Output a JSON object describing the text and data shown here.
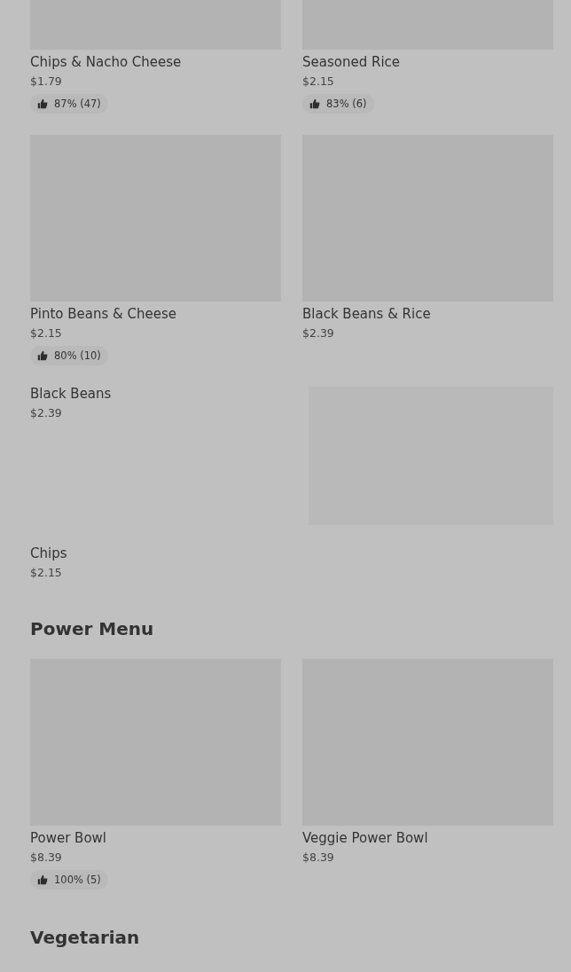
{
  "sections": [
    {
      "items": [
        {
          "kind": "photo-dish",
          "name": "Chips & Nacho Cheese",
          "price": "$1.79",
          "rating": "87% (47)"
        },
        {
          "kind": "photo-dish",
          "name": "Seasoned Rice",
          "price": "$2.15",
          "rating": "83% (6)"
        },
        {
          "kind": "photo-dish",
          "name": "Pinto Beans & Cheese",
          "price": "$2.15",
          "rating": "80% (10)"
        },
        {
          "kind": "photo-dish",
          "name": "Black Beans & Rice",
          "price": "$2.39"
        },
        {
          "kind": "text-dish",
          "name": "Black Beans",
          "price": "$2.39"
        },
        {
          "kind": "tile"
        },
        {
          "kind": "text-dish",
          "name": "Chips",
          "price": "$2.15"
        }
      ]
    },
    {
      "title": "Power Menu",
      "items": [
        {
          "kind": "photo-dish",
          "name": "Power Bowl",
          "price": "$8.39",
          "rating": "100% (5)"
        },
        {
          "kind": "photo-dish",
          "name": "Veggie Power Bowl",
          "price": "$8.39"
        }
      ]
    },
    {
      "title": "Vegetarian"
    }
  ]
}
